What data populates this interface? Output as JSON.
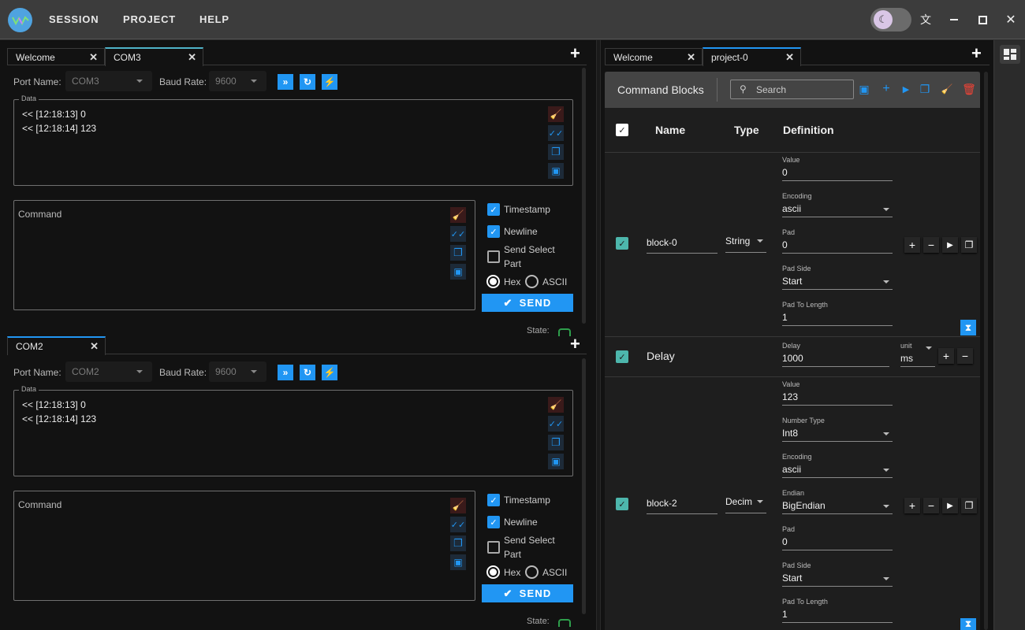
{
  "menu": {
    "session": "SESSION",
    "project": "PROJECT",
    "help": "HELP"
  },
  "window": {
    "theme": "dark",
    "translate_icon": "translate-icon",
    "minimize_icon": "minimize-icon",
    "maximize_icon": "maximize-icon",
    "close_icon": "close-icon"
  },
  "left_tabs": [
    {
      "label": "Welcome",
      "active": false
    },
    {
      "label": "COM3",
      "active": true
    }
  ],
  "lower_tabs": [
    {
      "label": "COM2",
      "active": true
    }
  ],
  "right_tabs": [
    {
      "label": "Welcome",
      "active": false
    },
    {
      "label": "project-0",
      "active": true
    }
  ],
  "ports": [
    {
      "port_label": "Port Name:",
      "port_value": "COM3",
      "baud_label": "Baud Rate:",
      "baud_value": "9600",
      "data_legend": "Data",
      "log": [
        "<< [12:18:13] 0",
        "<< [12:18:14] 123"
      ],
      "command_label": "Command",
      "options": {
        "timestamp": {
          "label": "Timestamp",
          "checked": true
        },
        "newline": {
          "label": "Newline",
          "checked": true
        },
        "send_select": {
          "label_line1": "Send Select",
          "label_line2": "Part",
          "checked": false
        }
      },
      "format": {
        "hex": "Hex",
        "ascii": "ASCII",
        "selected": "Hex"
      },
      "send_label": "SEND",
      "state_label": "State:"
    },
    {
      "port_label": "Port Name:",
      "port_value": "COM2",
      "baud_label": "Baud Rate:",
      "baud_value": "9600",
      "data_legend": "Data",
      "log": [
        "<< [12:18:13] 0",
        "<< [12:18:14] 123"
      ],
      "command_label": "Command",
      "options": {
        "timestamp": {
          "label": "Timestamp",
          "checked": true
        },
        "newline": {
          "label": "Newline",
          "checked": true
        },
        "send_select": {
          "label_line1": "Send Select",
          "label_line2": "Part",
          "checked": false
        }
      },
      "format": {
        "hex": "Hex",
        "ascii": "ASCII",
        "selected": "Hex"
      },
      "send_label": "SEND",
      "state_label": "State:"
    }
  ],
  "command_blocks": {
    "title": "Command Blocks",
    "search_placeholder": "Search",
    "columns": {
      "name": "Name",
      "type": "Type",
      "definition": "Definition"
    },
    "rows": [
      {
        "name": "block-0",
        "type": "String",
        "fields": [
          {
            "label": "Value",
            "value": "0",
            "dropdown": false
          },
          {
            "label": "Encoding",
            "value": "ascii",
            "dropdown": true
          },
          {
            "label": "Pad",
            "value": "0",
            "dropdown": false
          },
          {
            "label": "Pad Side",
            "value": "Start",
            "dropdown": true
          },
          {
            "label": "Pad To Length",
            "value": "1",
            "dropdown": false
          }
        ]
      },
      {
        "name": "Delay",
        "delay_label": "Delay",
        "delay_value": "1000",
        "unit_label": "unit",
        "unit_value": "ms"
      },
      {
        "name": "block-2",
        "type": "Decim",
        "fields": [
          {
            "label": "Value",
            "value": "123",
            "dropdown": false
          },
          {
            "label": "Number Type",
            "value": "Int8",
            "dropdown": true
          },
          {
            "label": "Encoding",
            "value": "ascii",
            "dropdown": true
          },
          {
            "label": "Endian",
            "value": "BigEndian",
            "dropdown": true
          },
          {
            "label": "Pad",
            "value": "0",
            "dropdown": false
          },
          {
            "label": "Pad Side",
            "value": "Start",
            "dropdown": true
          },
          {
            "label": "Pad To Length",
            "value": "1",
            "dropdown": false
          }
        ]
      }
    ]
  },
  "colors": {
    "accent": "#2196f3",
    "teal": "#4db6ac",
    "danger": "#f44336",
    "ok": "#2e9e4b"
  }
}
